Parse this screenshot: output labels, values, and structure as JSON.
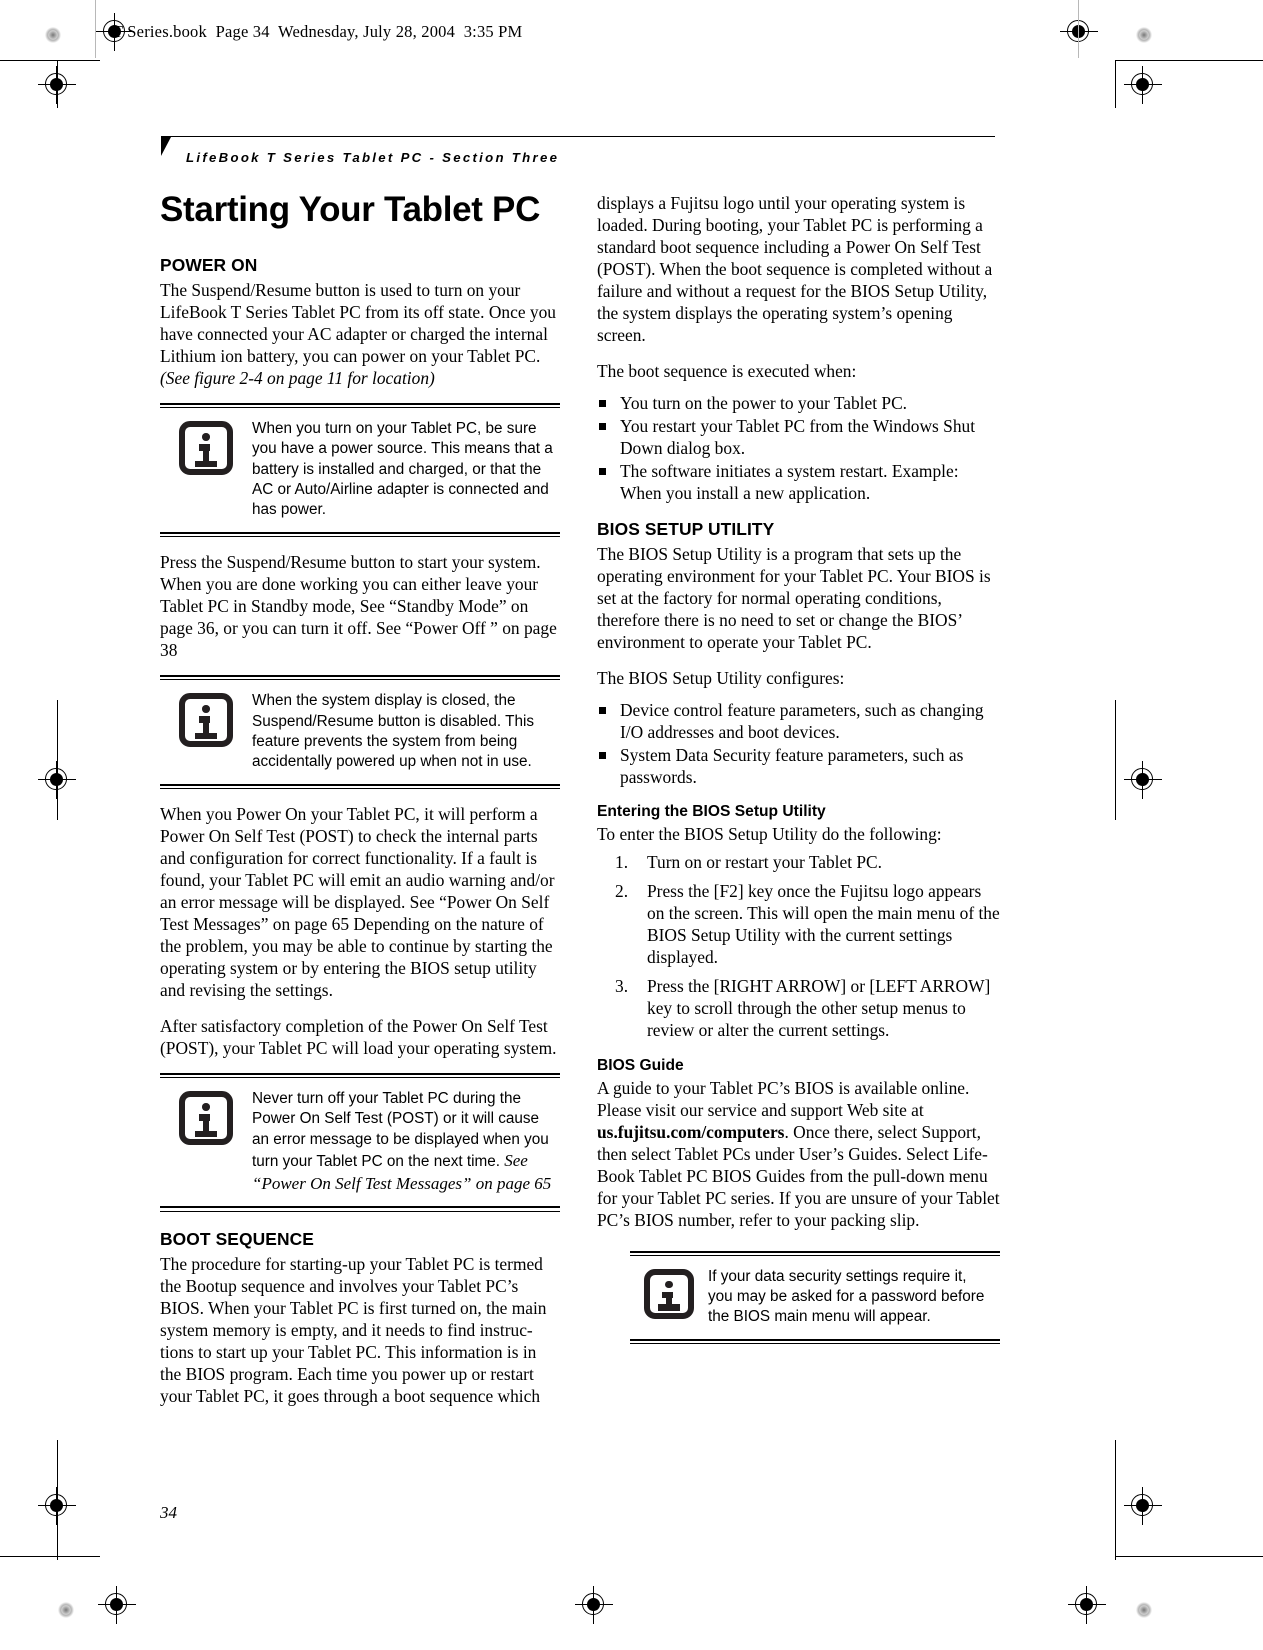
{
  "file_stamp": "T Series.book  Page 34  Wednesday, July 28, 2004  3:35 PM",
  "running_header": "LifeBook T Series Tablet PC - Section Three",
  "page_number": "34",
  "title": "Starting Your Tablet PC",
  "left_column": {
    "power_on": {
      "heading": "POWER ON",
      "para_1": "The Suspend/Resume button is used to turn on your LifeBook T Series Tablet PC from its off state. Once you have connected your AC adapter or charged the internal Lithium ion battery, you can power on your Tablet PC. ",
      "para_1_italic": "(See figure 2-4 on page 11 for location)",
      "info_1": "When you turn on your Tablet PC, be sure you have a power source. This means that a battery is installed and charged, or that the AC or Auto/Airline adapter is connected and has power.",
      "para_2": "Press the Suspend/Resume button to start your system. When you are done working you can either leave your Tablet PC in Standby mode, See “Standby Mode” on page 36, or you can turn it off. See “Power Off ” on page 38",
      "info_2": "When the system display is closed, the Suspend/Resume button is disabled. This feature prevents the system from being accidentally powered up when not in use.",
      "para_3": "When you Power On your Tablet PC, it will perform a Power On Self Test (POST) to check the internal parts and configuration for correct functionality. If a fault is found, your Tablet PC will emit an audio warning and/or an error message will be displayed. See “Power On Self Test Messages” on page 65 Depending on the nature of the problem, you may be able to continue by starting the operating system or by entering the BIOS setup utility and revising the settings.",
      "para_4": "After satisfactory completion of the Power On Self Test (POST), your Tablet PC will load your operating system.",
      "info_3_plain": "Never turn off your Tablet PC during the Power On Self Test (POST) or it will cause an error message to be displayed when you turn your Tablet PC on the next time. ",
      "info_3_italic": "See “Power On Self Test Messages” on page 65"
    },
    "boot_sequence": {
      "heading": "BOOT SEQUENCE",
      "para_1": "The procedure for starting-up your Tablet PC is termed the Bootup sequence and involves your Tablet PC’s BIOS. When your Tablet PC is first turned on, the main system memory is empty, and it needs to find instruc-tions to start up your Tablet PC. This information is in the BIOS program. Each time you power up or restart your Tablet PC, it goes through a boot sequence which"
    }
  },
  "right_column": {
    "continued_para": "displays a Fujitsu logo until your operating system is loaded. During booting, your Tablet PC is performing a standard boot sequence including a Power On Self Test (POST). When the boot sequence is completed without a failure and without a request for the BIOS Setup Utility, the system displays the operating system’s opening screen.",
    "boot_exec_lead": "The boot sequence is executed when:",
    "boot_exec_items": [
      "You turn on the power to your Tablet PC.",
      "You restart your Tablet PC from the Windows Shut Down dialog box.",
      "The software initiates a system restart. Example: When you install a new application."
    ],
    "bios_setup": {
      "heading": "BIOS SETUP UTILITY",
      "para_1": "The BIOS Setup Utility is a program that sets up the operating environment for your Tablet PC. Your BIOS is set at the factory for normal operating conditions, therefore there is no need to set or change the BIOS’ environment to operate your Tablet PC.",
      "para_2": "The BIOS Setup Utility configures:",
      "configures_items": [
        "Device control feature parameters, such as changing I/O addresses and boot devices.",
        "System Data Security feature parameters, such as passwords."
      ]
    },
    "entering_bios": {
      "heading": "Entering the BIOS Setup Utility",
      "lead": "To enter the BIOS Setup Utility do the following:",
      "steps": [
        "Turn on or restart your Tablet PC.",
        "Press the [F2] key once the Fujitsu logo appears on the screen. This will open the main menu of the BIOS Setup Utility with the current settings displayed.",
        "Press the [RIGHT ARROW] or [LEFT ARROW] key to scroll through the other setup menus to review or alter the current settings."
      ]
    },
    "bios_guide": {
      "heading": "BIOS Guide",
      "para_part1": "A guide to your Tablet PC’s BIOS is available online. Please visit our service and support Web site at ",
      "para_url": "us.fujitsu.com/computers",
      "para_part2": ". Once there, select Support, then select Tablet PCs under User’s Guides. Select Life-Book Tablet PC BIOS Guides from the pull-down menu for your Tablet PC series. If you are unsure of your Tablet PC’s BIOS number, refer to your packing slip.",
      "info_note": "If your data security settings require it, you may be asked for a password before the BIOS main menu will appear."
    }
  }
}
